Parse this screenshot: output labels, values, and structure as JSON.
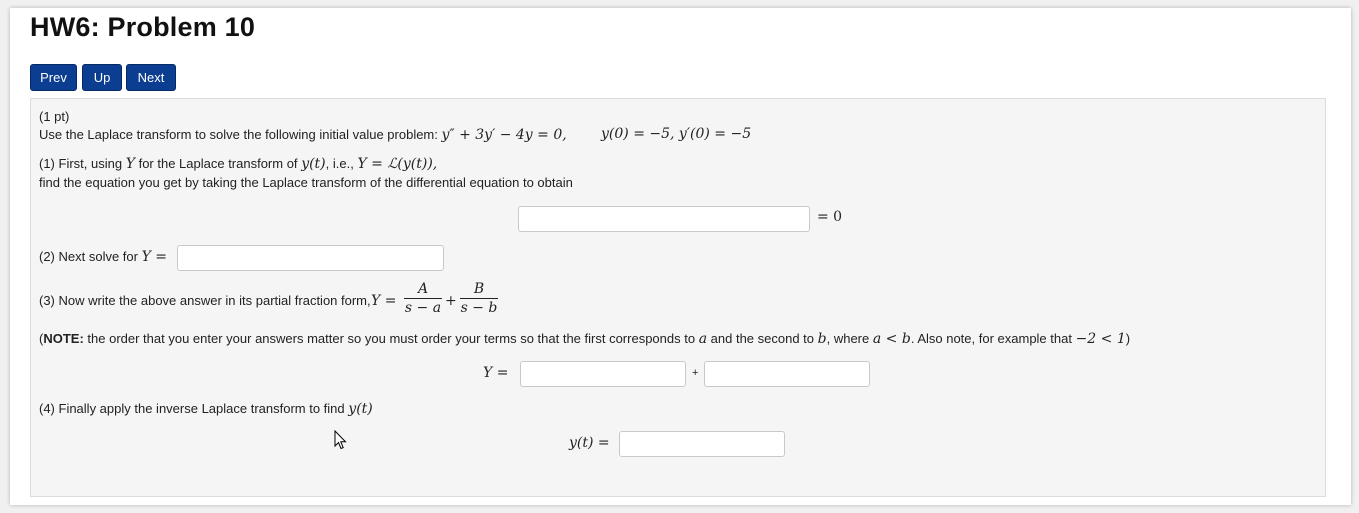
{
  "header": {
    "title": "HW6: Problem 10"
  },
  "nav": {
    "prev_label": "Prev",
    "up_label": "Up",
    "next_label": "Next"
  },
  "colors": {
    "nav_button": "#0b3d91",
    "panel": "#f5f5f5"
  },
  "problem": {
    "points": "(1 pt)",
    "intro": "Use the Laplace transform to solve the following initial value problem:",
    "ode": "y″ + 3y′ − 4y = 0,",
    "initial_conditions": "y(0) = −5,  y′(0) = −5",
    "part1": {
      "text_a": "(1) First, using",
      "Y": "Y",
      "text_b": "for the Laplace transform of",
      "yt": "y(t)",
      "text_c": ", i.e.,",
      "def": "Y = ℒ(y(t)),",
      "text_d": "find the equation you get by taking the Laplace transform of the differential equation to obtain",
      "equals": "= 0"
    },
    "part2": {
      "text": "(2) Next solve for",
      "rhs": "Y ="
    },
    "part3": {
      "text": "(3) Now write the above answer in its partial fraction form,",
      "lhs": "Y =",
      "frac1_num": "A",
      "frac1_den": "s − a",
      "plus": "+",
      "frac2_num": "B",
      "frac2_den": "s − b"
    },
    "note": {
      "open": "(",
      "bold": "NOTE:",
      "text_a": " the order that you enter your answers matter so you must order your terms so that the first corresponds to ",
      "a": "a",
      "text_b": " and the second to ",
      "b": "b",
      "text_c": ", where ",
      "cond": "a < b",
      "text_d": ". Also note, for example that ",
      "example": "−2 < 1",
      "close": ")"
    },
    "answer_row": {
      "lhs": "Y =",
      "plus": "+"
    },
    "part4": {
      "text": "(4) Finally apply the inverse Laplace transform to find",
      "yt": "y(t)",
      "lhs": "y(t) ="
    }
  }
}
